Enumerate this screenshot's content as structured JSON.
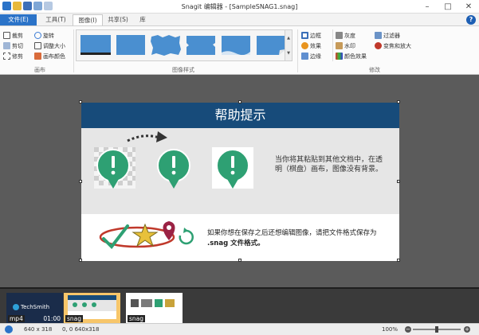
{
  "window": {
    "title": "Snagit 编辑器 - [SampleSNAG1.snag]",
    "controls": [
      "–",
      "□",
      "✕"
    ]
  },
  "tabs": [
    "文件(E)",
    "工具(T)",
    "图像(I)",
    "共享(S)",
    "库"
  ],
  "help_label": "?",
  "ribbon": {
    "canvas_group": {
      "label": "画布",
      "items": [
        "裁剪",
        "剪切",
        "修剪",
        "旋转",
        "调整大小",
        "画布颜色"
      ]
    },
    "styles_group": {
      "label": "图像样式"
    },
    "effects_group": {
      "label": "修改",
      "items": [
        "边框",
        "效果",
        "边缘",
        "灰度",
        "水印",
        "颜色效果",
        "过滤器",
        "变焦和放大"
      ]
    }
  },
  "image": {
    "header": "帮助提示",
    "middle_text": "当你将其粘贴到其他文档中，在透明（棋盘）画布，图像没有背景。",
    "bottom_text": "如果你想在保存之后还想编辑图像，请把文件格式保存为",
    "bottom_bold": ".snag 文件格式。"
  },
  "tray": [
    {
      "label": "mp4",
      "time": "01:00",
      "caption": "TechSmith"
    },
    {
      "label": "snag"
    },
    {
      "label": "snag"
    }
  ],
  "status": {
    "size": "640 x 318",
    "pos": "0, 0  640x318",
    "zoom": "100%"
  },
  "colors": {
    "accent": "#2b73c8",
    "header": "#174b7a",
    "icon_green": "#2ea073",
    "tray_selected": "#f7c66a"
  }
}
